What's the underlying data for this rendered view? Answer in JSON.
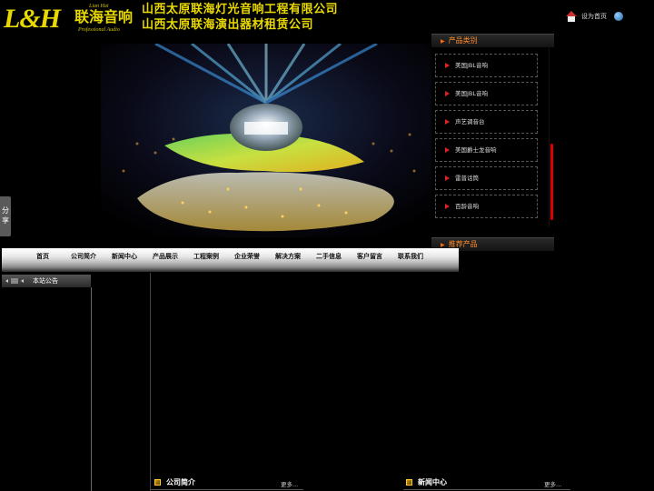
{
  "header": {
    "logo_main": "L&H",
    "logo_cn": "联海音响",
    "logo_pinyin": "Lian Hai",
    "logo_en": "Professional Audio",
    "company_line1": "山西太原联海灯光音响工程有限公司",
    "company_line2": "山西太原联海演出器材租赁公司",
    "set_home": "设为首页",
    "icons": [
      "house-icon",
      "favorite-icon"
    ]
  },
  "sidebar": {
    "category_title": "产品类别",
    "categories": [
      "美国JBL音响",
      "美国JBL音响",
      "声艺调音台",
      "美国爵士龙音响",
      "雷普话筒",
      "百龄音响"
    ],
    "recommend_title": "推荐产品"
  },
  "share": {
    "label": "分享"
  },
  "nav": {
    "items": [
      "首页",
      "公司简介",
      "新闻中心",
      "产品展示",
      "工程案例",
      "企业荣誉",
      "解决方案",
      "二手信息",
      "客户留言",
      "联系我们"
    ]
  },
  "notice": {
    "title": "本站公告"
  },
  "sections": {
    "company_title": "公司简介",
    "news_title": "新闻中心",
    "more": "更多..."
  },
  "colors": {
    "accent_yellow": "#e8d800",
    "accent_orange": "#ff8a2a",
    "scroll_red": "#dd0000"
  }
}
